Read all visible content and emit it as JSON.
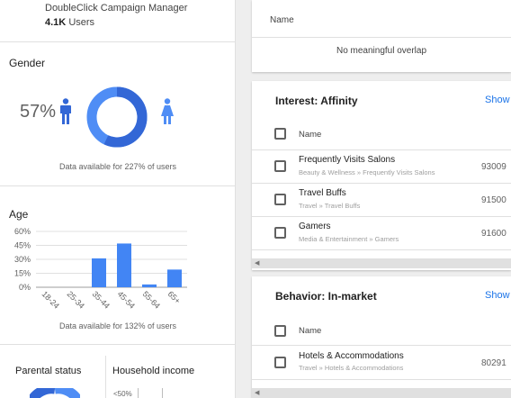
{
  "header": {
    "source": "DoubleClick Campaign Manager",
    "users_count": "4.1K",
    "users_label": "Users"
  },
  "gender": {
    "title": "Gender",
    "male_pct": "57%",
    "female_pct": "43%",
    "male_share": 0.57,
    "female_share": 0.43,
    "note": "Data available for 227% of users",
    "colors": {
      "male": "#3367d6",
      "female": "#4f8df5"
    }
  },
  "age": {
    "title": "Age",
    "note": "Data available for 132% of users",
    "chart_data": {
      "type": "bar",
      "categories": [
        "18-24",
        "25-34",
        "35-44",
        "45-54",
        "55-64",
        "65+"
      ],
      "values": [
        0,
        0,
        31,
        47,
        3,
        19
      ],
      "yticks": [
        "60%",
        "45%",
        "30%",
        "15%",
        "0%"
      ],
      "ylim": [
        0,
        60
      ],
      "grid": true,
      "color": "#4285f4"
    }
  },
  "bottom": {
    "parental_title": "Parental status",
    "household_title": "Household income",
    "household_tick": "<50%"
  },
  "overlap_card": {
    "name_header": "Name",
    "empty_text": "No meaningful overlap"
  },
  "affinity_card": {
    "title": "Interest: Affinity",
    "show_label": "Show",
    "name_header": "Name",
    "rows": [
      {
        "name": "Frequently Visits Salons",
        "path": "Beauty & Wellness » Frequently Visits Salons",
        "value": "93009"
      },
      {
        "name": "Travel Buffs",
        "path": "Travel » Travel Buffs",
        "value": "91500"
      },
      {
        "name": "Gamers",
        "path": "Media & Entertainment » Gamers",
        "value": "91600"
      }
    ]
  },
  "inmarket_card": {
    "title": "Behavior: In-market",
    "show_label": "Show",
    "name_header": "Name",
    "rows": [
      {
        "name": "Hotels & Accommodations",
        "path": "Travel » Hotels & Accommodations",
        "value": "80291"
      }
    ]
  }
}
